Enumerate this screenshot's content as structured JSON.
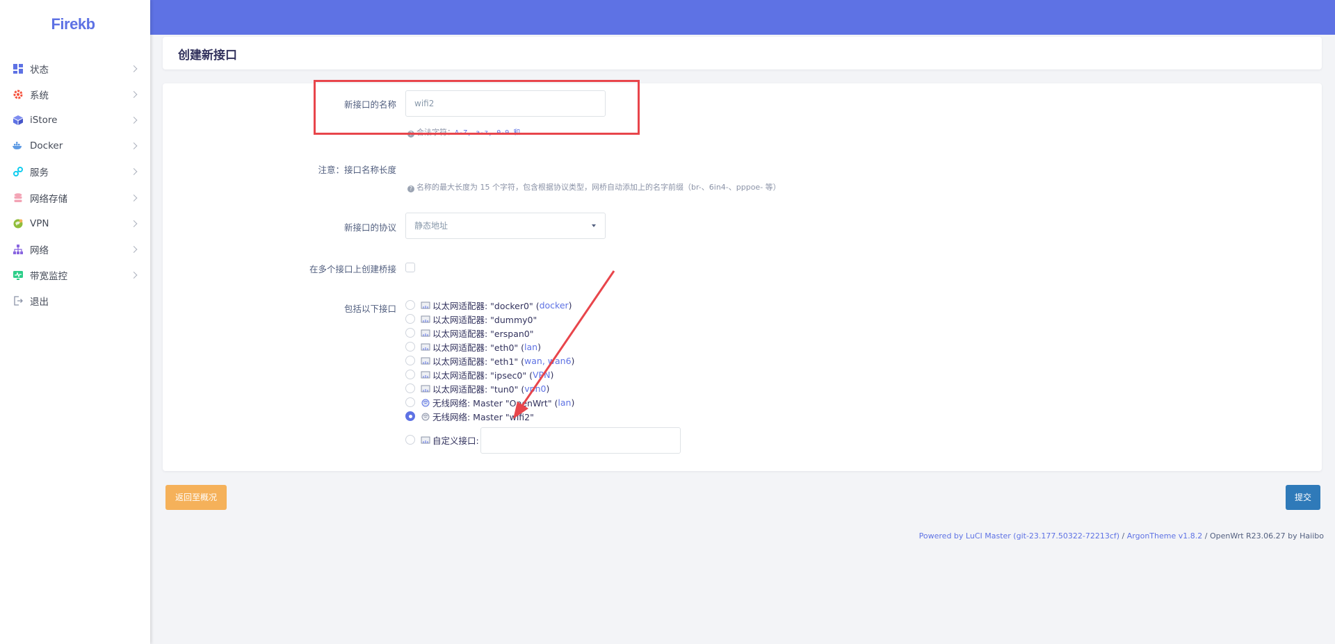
{
  "logo": "Firekb",
  "sidebar": {
    "items": [
      {
        "label": "状态",
        "icon": "dashboard-icon"
      },
      {
        "label": "系统",
        "icon": "gear-icon"
      },
      {
        "label": "iStore",
        "icon": "box-icon"
      },
      {
        "label": "Docker",
        "icon": "docker-icon"
      },
      {
        "label": "服务",
        "icon": "services-icon"
      },
      {
        "label": "网络存储",
        "icon": "database-icon"
      },
      {
        "label": "VPN",
        "icon": "vpn-icon"
      },
      {
        "label": "网络",
        "icon": "network-icon"
      },
      {
        "label": "带宽监控",
        "icon": "monitor-icon"
      },
      {
        "label": "退出",
        "icon": "logout-icon"
      }
    ]
  },
  "page": {
    "title": "创建新接口"
  },
  "form": {
    "name_label": "新接口的名称",
    "name_value": "wifi2",
    "name_hint_prefix": "合法字符：",
    "name_hint_codes": "A-Z, a-z, 0-9 和",
    "note_label": "注意：接口名称长度",
    "note_hint": "名称的最大长度为 15 个字符，包含根据协议类型，网桥自动添加上的名字前缀（br-、6in4-、pppoe- 等）",
    "protocol_label": "新接口的协议",
    "protocol_value": "静态地址",
    "bridge_label": "在多个接口上创建桥接",
    "include_label": "包括以下接口",
    "custom_label": "自定义接口:",
    "interfaces": [
      {
        "text": "以太网适配器: \"docker0\" (",
        "link": "docker",
        "suffix": ")"
      },
      {
        "text": "以太网适配器: \"dummy0\"",
        "link": "",
        "suffix": ""
      },
      {
        "text": "以太网适配器: \"erspan0\"",
        "link": "",
        "suffix": ""
      },
      {
        "text": "以太网适配器: \"eth0\" (",
        "link": "lan",
        "suffix": ")"
      },
      {
        "text": "以太网适配器: \"eth1\" (",
        "link": "wan, wan6",
        "suffix": ")"
      },
      {
        "text": "以太网适配器: \"ipsec0\" (",
        "link": "VPN",
        "suffix": ")"
      },
      {
        "text": "以太网适配器: \"tun0\" (",
        "link": "vpn0",
        "suffix": ")"
      },
      {
        "text": "无线网络: Master \"OpenWrt\" (",
        "link": "lan",
        "suffix": ")"
      },
      {
        "text": "无线网络: Master \"wifi2\"",
        "link": "",
        "suffix": ""
      }
    ],
    "selected_index": 8
  },
  "buttons": {
    "back": "返回至概况",
    "submit": "提交"
  },
  "footer": {
    "luci": "Powered by LuCI Master (git-23.177.50322-72213cf)",
    "sep1": " / ",
    "argon": "ArgonTheme v1.8.2",
    "rest": " / OpenWrt R23.06.27 by Haiibo"
  },
  "colors": {
    "accent": "#5e72e4",
    "annotation": "#e8454b",
    "back_button": "#f5b15a",
    "submit_button": "#2f7ab9"
  }
}
